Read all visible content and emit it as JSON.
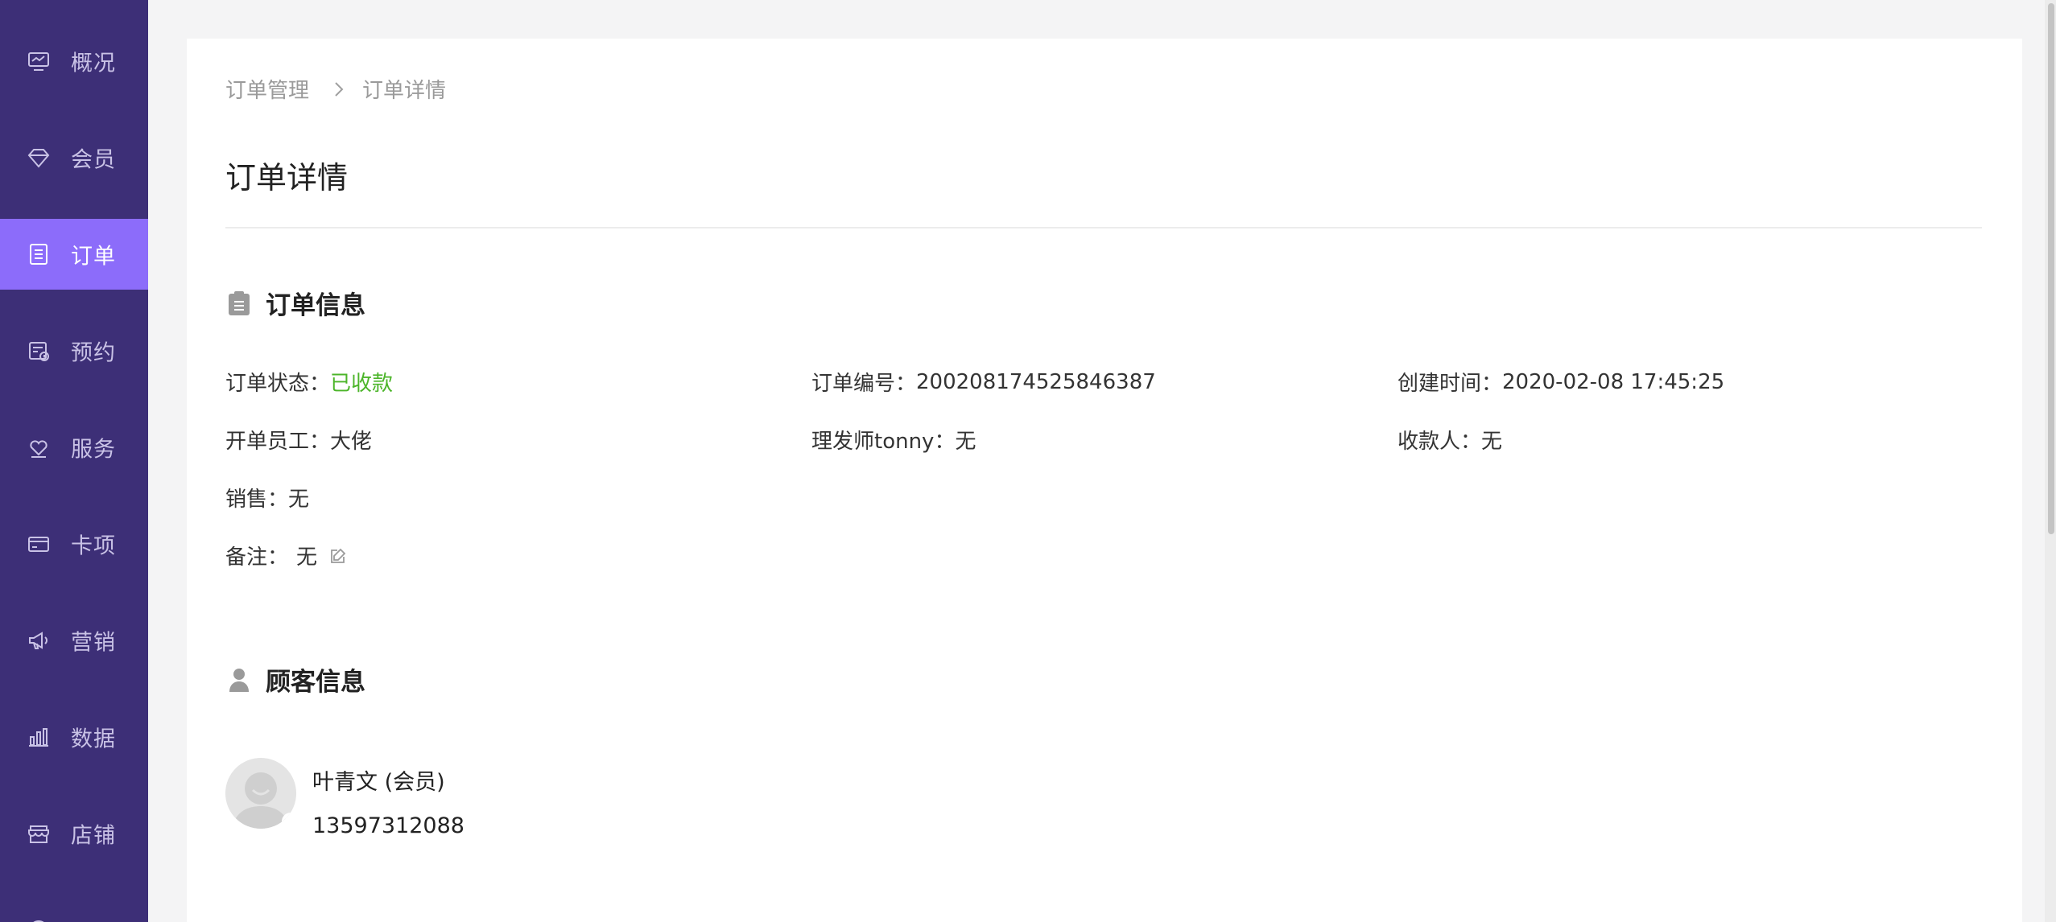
{
  "sidebar": {
    "items": [
      {
        "label": "概况",
        "icon": "monitor-icon",
        "active": false
      },
      {
        "label": "会员",
        "icon": "diamond-icon",
        "active": false
      },
      {
        "label": "订单",
        "icon": "clipboard-list-icon",
        "active": true
      },
      {
        "label": "预约",
        "icon": "calendar-clock-icon",
        "active": false
      },
      {
        "label": "服务",
        "icon": "heart-hand-icon",
        "active": false
      },
      {
        "label": "卡项",
        "icon": "card-icon",
        "active": false
      },
      {
        "label": "营销",
        "icon": "megaphone-icon",
        "active": false
      },
      {
        "label": "数据",
        "icon": "bar-chart-icon",
        "active": false
      },
      {
        "label": "店铺",
        "icon": "store-icon",
        "active": false
      }
    ],
    "colors": {
      "background": "#3d2f77",
      "active": "#8c6cfa"
    }
  },
  "breadcrumb": {
    "items": [
      "订单管理",
      "订单详情"
    ]
  },
  "page": {
    "title": "订单详情"
  },
  "order_section": {
    "title": "订单信息",
    "icon": "clipboard-icon",
    "fields": {
      "status": {
        "label": "订单状态：",
        "value": "已收款",
        "color": "#4cb52a"
      },
      "order_no": {
        "label": "订单编号：",
        "value": "200208174525846387"
      },
      "created": {
        "label": "创建时间：",
        "value": "2020-02-08 17:45:25"
      },
      "staff": {
        "label": "开单员工：",
        "value": "大佬"
      },
      "barber": {
        "label": "理发师tonny：",
        "value": "无"
      },
      "cashier": {
        "label": "收款人：",
        "value": "无"
      },
      "sales": {
        "label": "销售：",
        "value": "无"
      },
      "remark": {
        "label": "备注：",
        "value": "无"
      }
    }
  },
  "customer_section": {
    "title": "顾客信息",
    "icon": "user-icon",
    "name": "叶青文 (会员)",
    "phone": "13597312088"
  }
}
